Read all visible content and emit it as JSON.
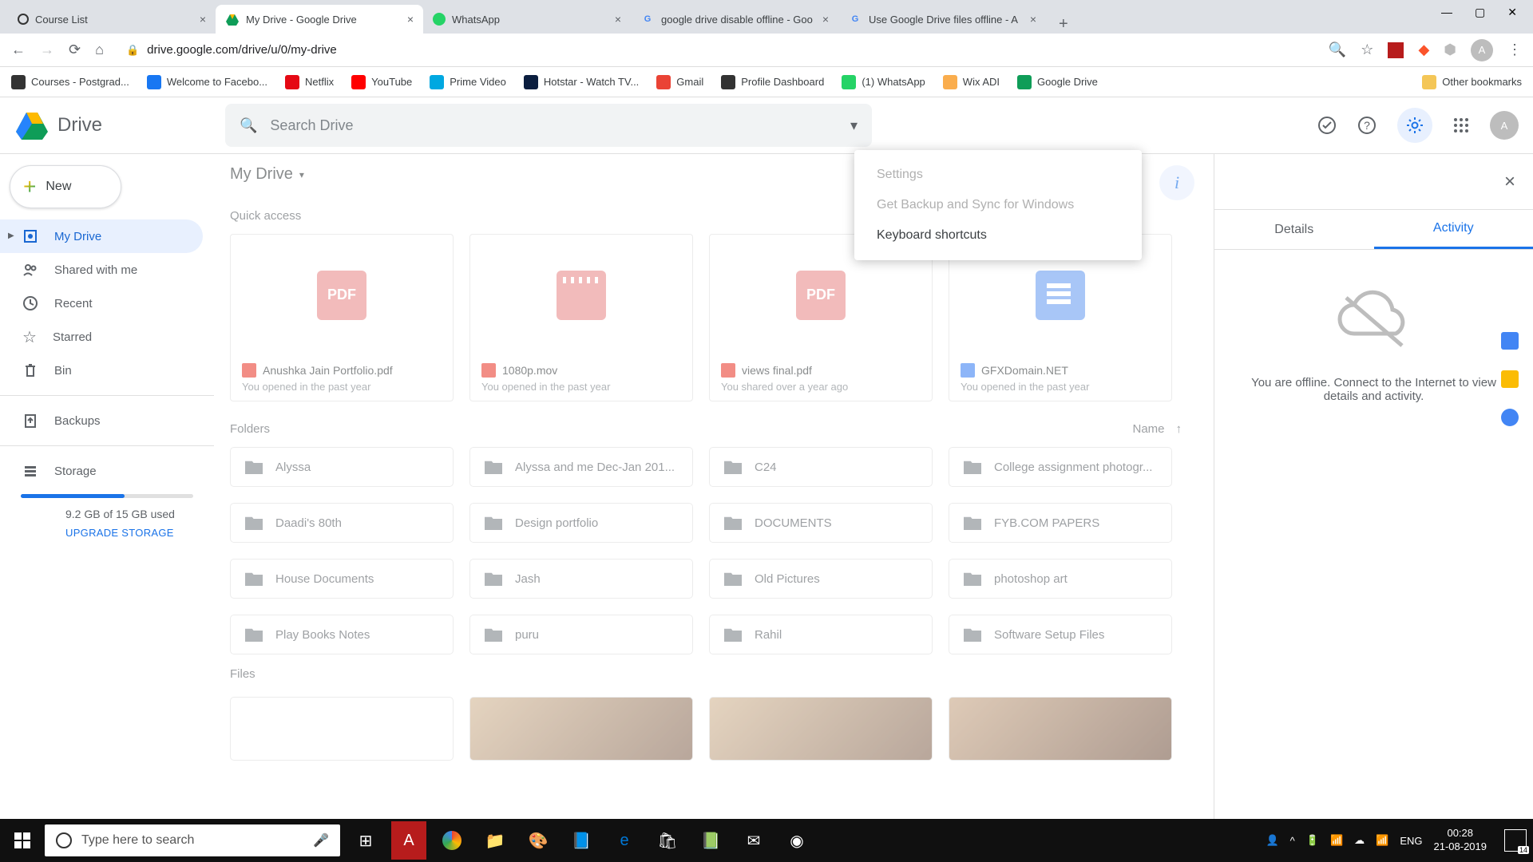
{
  "browser": {
    "tabs": [
      {
        "title": "Course List",
        "active": false
      },
      {
        "title": "My Drive - Google Drive",
        "active": true
      },
      {
        "title": "WhatsApp",
        "active": false
      },
      {
        "title": "google drive disable offline - Goo",
        "active": false
      },
      {
        "title": "Use Google Drive files offline - A",
        "active": false
      }
    ],
    "url": "drive.google.com/drive/u/0/my-drive",
    "avatar_letter": "A",
    "bookmarks": [
      {
        "label": "Courses - Postgrad...",
        "color": "#333"
      },
      {
        "label": "Welcome to Facebo...",
        "color": "#1877f2"
      },
      {
        "label": "Netflix",
        "color": "#e50914"
      },
      {
        "label": "YouTube",
        "color": "#ff0000"
      },
      {
        "label": "Prime Video",
        "color": "#00a8e1"
      },
      {
        "label": "Hotstar - Watch TV...",
        "color": "#0b1e3f"
      },
      {
        "label": "Gmail",
        "color": "#ea4335"
      },
      {
        "label": "Profile Dashboard",
        "color": "#333"
      },
      {
        "label": "(1) WhatsApp",
        "color": "#25d366"
      },
      {
        "label": "Wix ADI",
        "color": "#faad4d"
      },
      {
        "label": "Google Drive",
        "color": "#0f9d58"
      }
    ],
    "other_bookmarks": "Other bookmarks"
  },
  "drive": {
    "logo_text": "Drive",
    "search_placeholder": "Search Drive",
    "breadcrumb": "My Drive",
    "new_button": "New",
    "nav": [
      {
        "label": "My Drive",
        "active": true
      },
      {
        "label": "Shared with me",
        "active": false
      },
      {
        "label": "Recent",
        "active": false
      },
      {
        "label": "Starred",
        "active": false
      },
      {
        "label": "Bin",
        "active": false
      }
    ],
    "backups": "Backups",
    "storage_label": "Storage",
    "storage_used": "9.2 GB of 15 GB used",
    "upgrade": "UPGRADE STORAGE",
    "quick_access_label": "Quick access",
    "quick_access": [
      {
        "name": "Anushka Jain Portfolio.pdf",
        "sub": "You opened in the past year",
        "type": "pdf"
      },
      {
        "name": "1080p.mov",
        "sub": "You opened in the past year",
        "type": "video"
      },
      {
        "name": "views final.pdf",
        "sub": "You shared over a year ago",
        "type": "pdf"
      },
      {
        "name": "GFXDomain.NET",
        "sub": "You opened in the past year",
        "type": "doc"
      }
    ],
    "folders_label": "Folders",
    "sort_label": "Name",
    "folders": [
      "Alyssa",
      "Alyssa and me Dec-Jan 201...",
      "C24",
      "College assignment photogr...",
      "Daadi's 80th",
      "Design portfolio",
      "DOCUMENTS",
      "FYB.COM PAPERS",
      "House Documents",
      "Jash",
      "Old Pictures",
      "photoshop art",
      "Play Books Notes",
      "puru",
      "Rahil",
      "Software Setup Files"
    ],
    "files_label": "Files"
  },
  "settings_menu": {
    "items": [
      {
        "label": "Settings",
        "disabled": true
      },
      {
        "label": "Get Backup and Sync for Windows",
        "disabled": true
      },
      {
        "label": "Keyboard shortcuts",
        "disabled": false
      }
    ]
  },
  "details_panel": {
    "tab_details": "Details",
    "tab_activity": "Activity",
    "offline_msg": "You are offline. Connect to the Internet to view details and activity."
  },
  "taskbar": {
    "search_placeholder": "Type here to search",
    "lang": "ENG",
    "time": "00:28",
    "date": "21-08-2019"
  }
}
